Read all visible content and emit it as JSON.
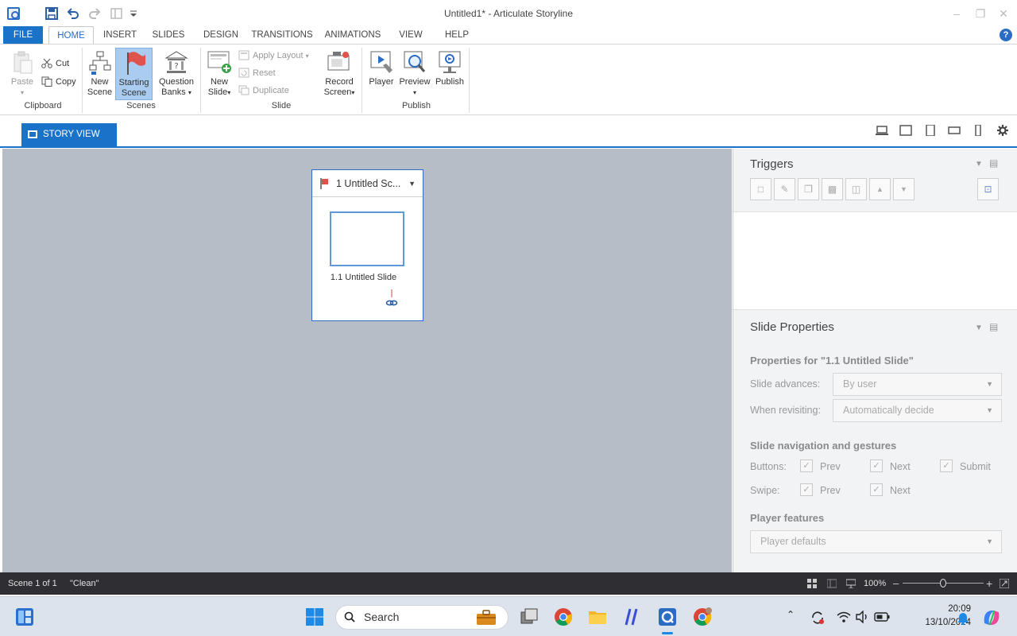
{
  "window": {
    "title": "Untitled1* -  Articulate Storyline"
  },
  "tabs": [
    {
      "label": "FILE"
    },
    {
      "label": "HOME"
    },
    {
      "label": "INSERT"
    },
    {
      "label": "SLIDES"
    },
    {
      "label": "DESIGN"
    },
    {
      "label": "TRANSITIONS"
    },
    {
      "label": "ANIMATIONS"
    },
    {
      "label": "VIEW"
    },
    {
      "label": "HELP"
    }
  ],
  "help_icon": "?",
  "ribbon": {
    "clipboard": {
      "paste": "Paste",
      "cut": "Cut",
      "copy": "Copy",
      "group": "Clipboard"
    },
    "scenes": {
      "new_scene_1": "New",
      "new_scene_2": "Scene",
      "starting_scene_1": "Starting",
      "starting_scene_2": "Scene",
      "question_banks_1": "Question",
      "question_banks_2": "Banks",
      "group": "Scenes"
    },
    "slide": {
      "new_slide_1": "New",
      "new_slide_2": "Slide",
      "apply_layout": "Apply Layout",
      "reset": "Reset",
      "duplicate": "Duplicate",
      "group": "Slide"
    },
    "record": {
      "label_1": "Record",
      "label_2": "Screen"
    },
    "publish": {
      "player": "Player",
      "preview": "Preview",
      "publish": "Publish",
      "group": "Publish"
    }
  },
  "view_tab": {
    "label": "STORY VIEW"
  },
  "scene": {
    "title": "1 Untitled Sc...",
    "slide_label": "1.1 Untitled Slide"
  },
  "triggers": {
    "title": "Triggers"
  },
  "slide_properties": {
    "title": "Slide Properties",
    "properties_for": "Properties for \"1.1 Untitled Slide\"",
    "slide_advances_label": "Slide advances:",
    "slide_advances_value": "By user",
    "when_revisiting_label": "When revisiting:",
    "when_revisiting_value": "Automatically decide",
    "nav_heading": "Slide navigation and gestures",
    "buttons_label": "Buttons:",
    "swipe_label": "Swipe:",
    "prev": "Prev",
    "next": "Next",
    "submit": "Submit",
    "player_features_heading": "Player features",
    "player_features_value": "Player defaults"
  },
  "status": {
    "scene_count": "Scene 1 of 1",
    "theme": "\"Clean\"",
    "zoom": "100%"
  },
  "taskbar": {
    "search_placeholder": "Search",
    "time": "20:09",
    "date": "13/10/2024"
  },
  "colors": {
    "accent": "#1b73c9",
    "canvas": "#b7bdc6",
    "statusbar": "#2f2f33",
    "taskbar": "#dde3ec"
  }
}
